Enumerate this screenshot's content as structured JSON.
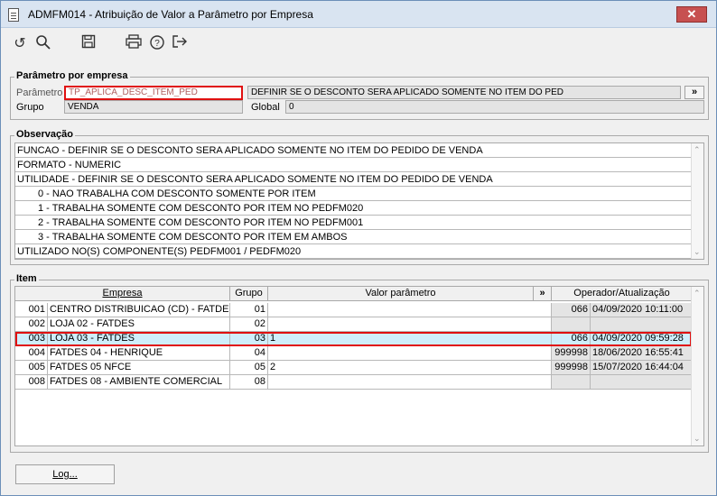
{
  "window": {
    "title": "ADMFM014 - Atribuição de Valor a Parâmetro por Empresa",
    "close_label": "✕"
  },
  "toolbar": {
    "icons": [
      "undo-icon",
      "search-icon",
      "save-icon",
      "print-icon",
      "help-icon",
      "exit-icon"
    ],
    "glyphs": {
      "undo": "↺",
      "search": "⚲",
      "save": "💾",
      "print": "⎙",
      "help": "?",
      "exit": "⇥"
    }
  },
  "parametro": {
    "legend": "Parâmetro por empresa",
    "parametro_label": "Parâmetro",
    "parametro_value": "TP_APLICA_DESC_ITEM_PED",
    "descricao_value": "DEFINIR SE O DESCONTO SERA APLICADO SOMENTE NO ITEM DO PED",
    "expand_label": "»",
    "grupo_label": "Grupo",
    "grupo_value": "VENDA",
    "global_label": "Global",
    "global_value": "0"
  },
  "observacao": {
    "legend": "Observação",
    "lines": [
      "FUNCAO - DEFINIR SE O DESCONTO SERA APLICADO SOMENTE NO ITEM DO PEDIDO DE VENDA",
      "FORMATO - NUMERIC",
      "UTILIDADE - DEFINIR SE O DESCONTO SERA APLICADO SOMENTE NO ITEM DO PEDIDO DE VENDA",
      "0 - NAO TRABALHA COM DESCONTO SOMENTE POR ITEM",
      "1 - TRABALHA SOMENTE COM DESCONTO POR ITEM NO PEDFM020",
      "2 - TRABALHA SOMENTE COM DESCONTO POR ITEM NO PEDFM001",
      "3 - TRABALHA SOMENTE COM DESCONTO POR ITEM EM AMBOS",
      "UTILIZADO NO(S) COMPONENTE(S) PEDFM001 / PEDFM020"
    ]
  },
  "item": {
    "legend": "Item",
    "columns": {
      "empresa": "Empresa",
      "grupo": "Grupo",
      "valor": "Valor parâmetro",
      "expand": "»",
      "operador": "Operador/Atualização"
    },
    "rows": [
      {
        "cod": "001",
        "empresa": "CENTRO DISTRIBUICAO (CD) - FATDES",
        "grupo": "01",
        "valor": "",
        "operador": "066",
        "data": "04/09/2020 10:11:00"
      },
      {
        "cod": "002",
        "empresa": "LOJA 02 - FATDES",
        "grupo": "02",
        "valor": "",
        "operador": "",
        "data": ""
      },
      {
        "cod": "003",
        "empresa": "LOJA 03 - FATDES",
        "grupo": "03",
        "valor": "1",
        "operador": "066",
        "data": "04/09/2020 09:59:28"
      },
      {
        "cod": "004",
        "empresa": "FATDES 04 - HENRIQUE",
        "grupo": "04",
        "valor": "",
        "operador": "999998",
        "data": "18/06/2020 16:55:41"
      },
      {
        "cod": "005",
        "empresa": "FATDES 05 NFCE",
        "grupo": "05",
        "valor": "2",
        "operador": "999998",
        "data": "15/07/2020 16:44:04"
      },
      {
        "cod": "008",
        "empresa": "FATDES 08 - AMBIENTE COMERCIAL",
        "grupo": "08",
        "valor": "",
        "operador": "",
        "data": ""
      }
    ]
  },
  "footer": {
    "log_label": "Log..."
  },
  "scroll": {
    "up": "⌃",
    "down": "⌄"
  }
}
